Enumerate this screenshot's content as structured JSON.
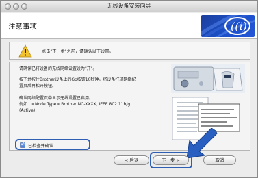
{
  "window": {
    "title": "无线设备安装向导"
  },
  "header": {
    "title": "注意事项"
  },
  "notice": {
    "text": "点击\"下一步\"之前，请确认以下设置。"
  },
  "instructions": {
    "line1": "请确保已将设备的无线网络设置设为\"开\"。",
    "line2a": "按下并按住Brother设备上的Go按钮10秒钟，将设备打印网络配",
    "line2b": "置页后再松开按钮。",
    "line3a": "确认网络配置页中显示无线设置已启用。",
    "line3b": "例如：<Node Type> Brother NC-XXXX, IEEE 802.11b/g",
    "line3c": "(Active)"
  },
  "confirm_checkbox": {
    "label": "已检查并确认",
    "checked": true
  },
  "buttons": {
    "back": "< 后退",
    "next": "下一步 >",
    "cancel": "取消"
  },
  "colors": {
    "highlight": "#2f5fb3",
    "logo_bg": "#1b4fc9",
    "warning": "#f2c12e"
  }
}
